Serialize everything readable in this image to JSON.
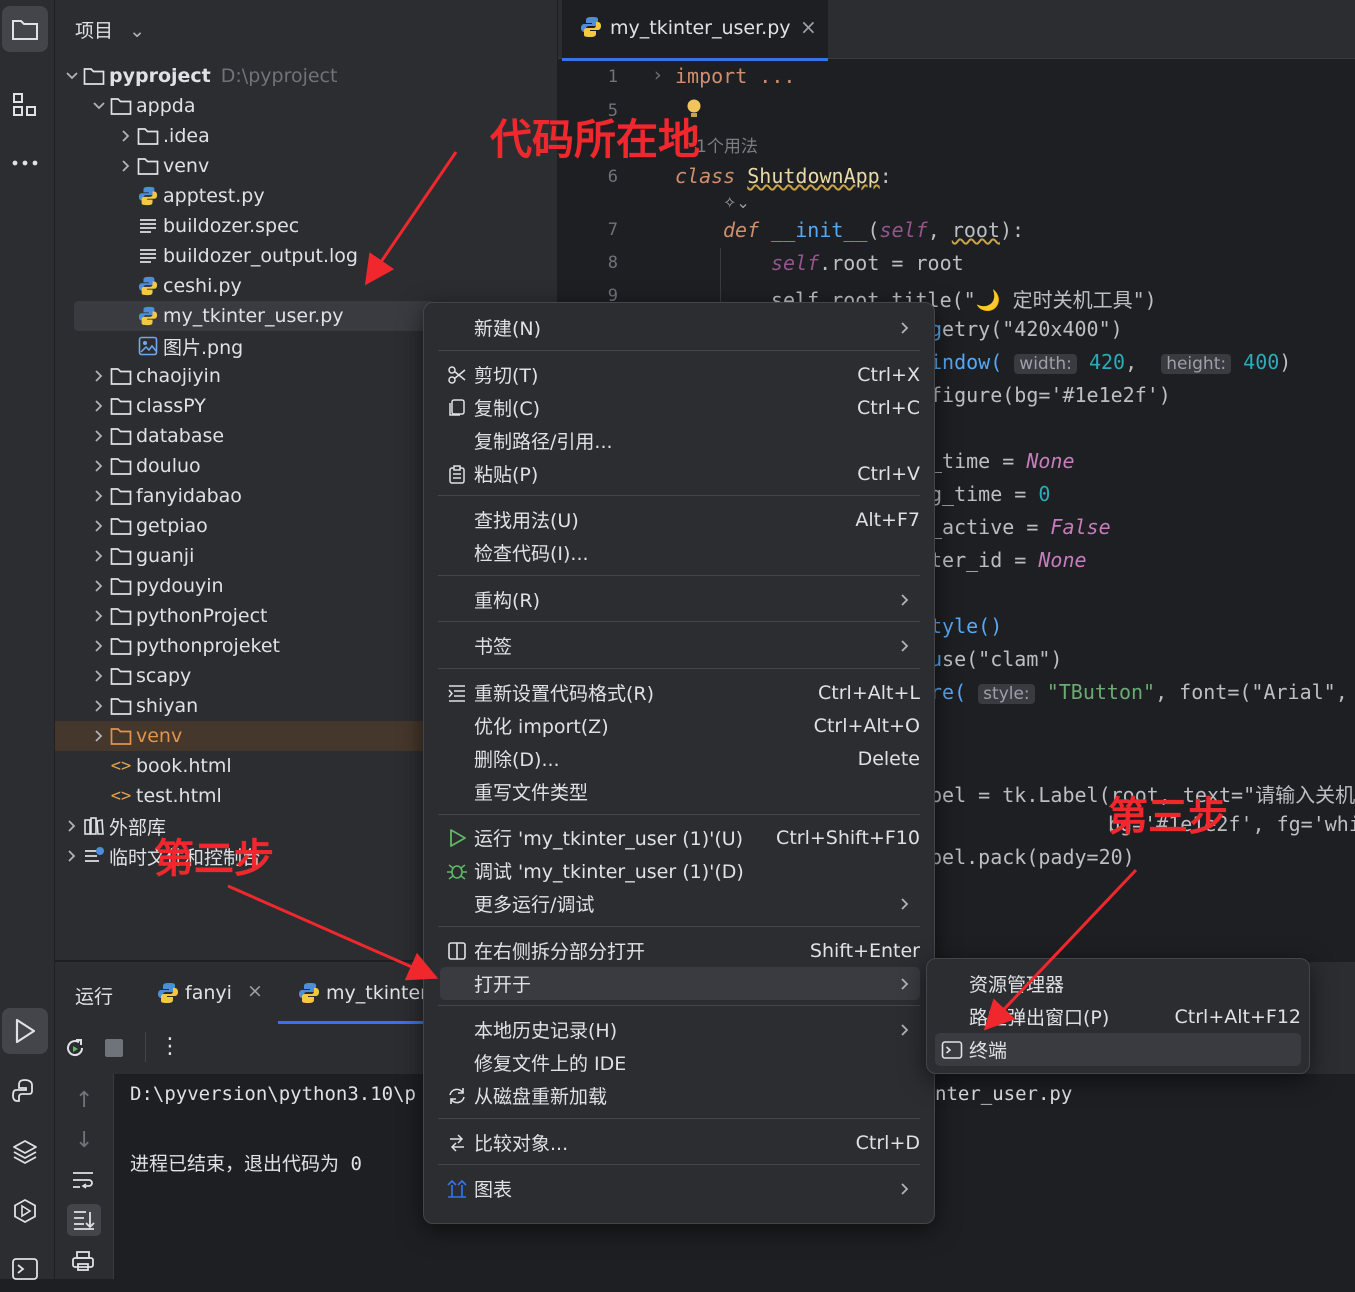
{
  "project_panel": {
    "title": "项目",
    "tree": [
      {
        "name": "pyproject",
        "suffix": "D:\\pyproject",
        "type": "folder",
        "expanded": true
      },
      {
        "name": "appda",
        "type": "folder",
        "expanded": true
      },
      {
        "name": ".idea",
        "type": "folder"
      },
      {
        "name": "venv",
        "type": "folder"
      },
      {
        "name": "apptest.py",
        "type": "python"
      },
      {
        "name": "buildozer.spec",
        "type": "text"
      },
      {
        "name": "buildozer_output.log",
        "type": "text"
      },
      {
        "name": "ceshi.py",
        "type": "python"
      },
      {
        "name": "my_tkinter_user.py",
        "type": "python",
        "selected": true
      },
      {
        "name": "图片.png",
        "type": "image"
      },
      {
        "name": "chaojiyin",
        "type": "folder"
      },
      {
        "name": "classPY",
        "type": "folder"
      },
      {
        "name": "database",
        "type": "folder"
      },
      {
        "name": "douluo",
        "type": "folder"
      },
      {
        "name": "fanyidabao",
        "type": "folder"
      },
      {
        "name": "getpiao",
        "type": "folder"
      },
      {
        "name": "guanji",
        "type": "folder"
      },
      {
        "name": "pydouyin",
        "type": "folder"
      },
      {
        "name": "pythonProject",
        "type": "folder"
      },
      {
        "name": "pythonprojeket",
        "type": "folder"
      },
      {
        "name": "scapy",
        "type": "folder"
      },
      {
        "name": "shiyan",
        "type": "folder"
      },
      {
        "name": "venv",
        "type": "folder",
        "excluded": true
      },
      {
        "name": "book.html",
        "type": "html"
      },
      {
        "name": "test.html",
        "type": "html"
      },
      {
        "name": "外部库",
        "type": "library"
      },
      {
        "name": "临时文件和控制台",
        "type": "scratch"
      }
    ]
  },
  "editor": {
    "tab_name": "my_tkinter_user.py",
    "usages_hint": "1个用法",
    "line_numbers": [
      "1",
      "5",
      "6",
      "7",
      "8",
      "9"
    ],
    "code": {
      "l1": "import ...",
      "l6_kw": "class",
      "l6_name": "ShutdownApp",
      "l7_kw": "def",
      "l7_fn": "__init__",
      "l7_self": "self",
      "l7_param": "root",
      "l8_self": "self",
      "l8_rest": ".root = root",
      "l9": "self.root.title(\"🌙 定时关机工具\")",
      "r1": "etry(\"420x400\")",
      "r2_a": "indow(",
      "r2_hint_w": "width:",
      "r2_w": "420",
      "r2_hint_h": "height:",
      "r2_h": "400",
      "r3": "figure(bg='#1e1e2f')",
      "r4_a": "_time = ",
      "r4_b": "None",
      "r5_a": "g_time = ",
      "r5_b": "0",
      "r6_a": "_active = ",
      "r6_b": "False",
      "r7_a": "ter_id = ",
      "r7_b": "None",
      "r8": "tyle()",
      "r9": "se(\"clam\")",
      "r10_a": "re(",
      "r10_hint": "style:",
      "r10_b": "\"TButton\"",
      "r10_c": ", font=(\"Arial\", 1",
      "r11_a": "bel = tk.Label(root, text=\"请输入关机倒",
      "r12": "bg='#1e1e2f', fg='whi",
      "r13": "bel.pack(pady=20)"
    }
  },
  "context_menu": {
    "items": [
      {
        "label": "新建(N)",
        "submenu": true
      },
      {
        "label": "剪切(T)",
        "shortcut": "Ctrl+X",
        "icon": "scissors-icon"
      },
      {
        "label": "复制(C)",
        "shortcut": "Ctrl+C",
        "icon": "copy-icon"
      },
      {
        "label": "复制路径/引用..."
      },
      {
        "label": "粘贴(P)",
        "shortcut": "Ctrl+V",
        "icon": "paste-icon"
      },
      {
        "label": "查找用法(U)",
        "shortcut": "Alt+F7"
      },
      {
        "label": "检查代码(I)..."
      },
      {
        "label": "重构(R)",
        "submenu": true
      },
      {
        "label": "书签",
        "submenu": true
      },
      {
        "label": "重新设置代码格式(R)",
        "shortcut": "Ctrl+Alt+L",
        "icon": "reformat-icon"
      },
      {
        "label": "优化 import(Z)",
        "shortcut": "Ctrl+Alt+O"
      },
      {
        "label": "删除(D)...",
        "shortcut": "Delete"
      },
      {
        "label": "重写文件类型"
      },
      {
        "label": "运行 'my_tkinter_user (1)'(U)",
        "shortcut": "Ctrl+Shift+F10",
        "icon": "run-icon"
      },
      {
        "label": "调试 'my_tkinter_user (1)'(D)",
        "icon": "debug-icon"
      },
      {
        "label": "更多运行/调试",
        "submenu": true
      },
      {
        "label": "在右侧拆分部分打开",
        "shortcut": "Shift+Enter",
        "icon": "split-icon"
      },
      {
        "label": "打开于",
        "submenu": true,
        "highlighted": true
      },
      {
        "label": "本地历史记录(H)",
        "submenu": true
      },
      {
        "label": "修复文件上的 IDE"
      },
      {
        "label": "从磁盘重新加载",
        "icon": "reload-icon"
      },
      {
        "label": "比较对象...",
        "shortcut": "Ctrl+D",
        "icon": "compare-icon"
      },
      {
        "label": "图表",
        "submenu": true,
        "icon": "diagram-icon"
      }
    ]
  },
  "submenu": {
    "items": [
      {
        "label": "资源管理器"
      },
      {
        "label": "路径弹出窗口(P)",
        "shortcut": "Ctrl+Alt+F12"
      },
      {
        "label": "终端",
        "icon": "terminal-icon",
        "highlighted": true
      }
    ]
  },
  "run_panel": {
    "title": "运行",
    "tabs": [
      "fanyi",
      "my_tkinter"
    ],
    "output_line1": "D:\\pyversion\\python3.10\\p",
    "output_line1_tail": "nter_user.py",
    "output_line2": "进程已结束，退出代码为 0"
  },
  "annotations": {
    "code_location": "代码所在地",
    "step2": "第二步",
    "step3": "第三步"
  },
  "colors": {
    "accent": "#3574f0",
    "annotation": "#f0282d",
    "panel": "#2b2d30",
    "editor_bg": "#1e1f22"
  }
}
